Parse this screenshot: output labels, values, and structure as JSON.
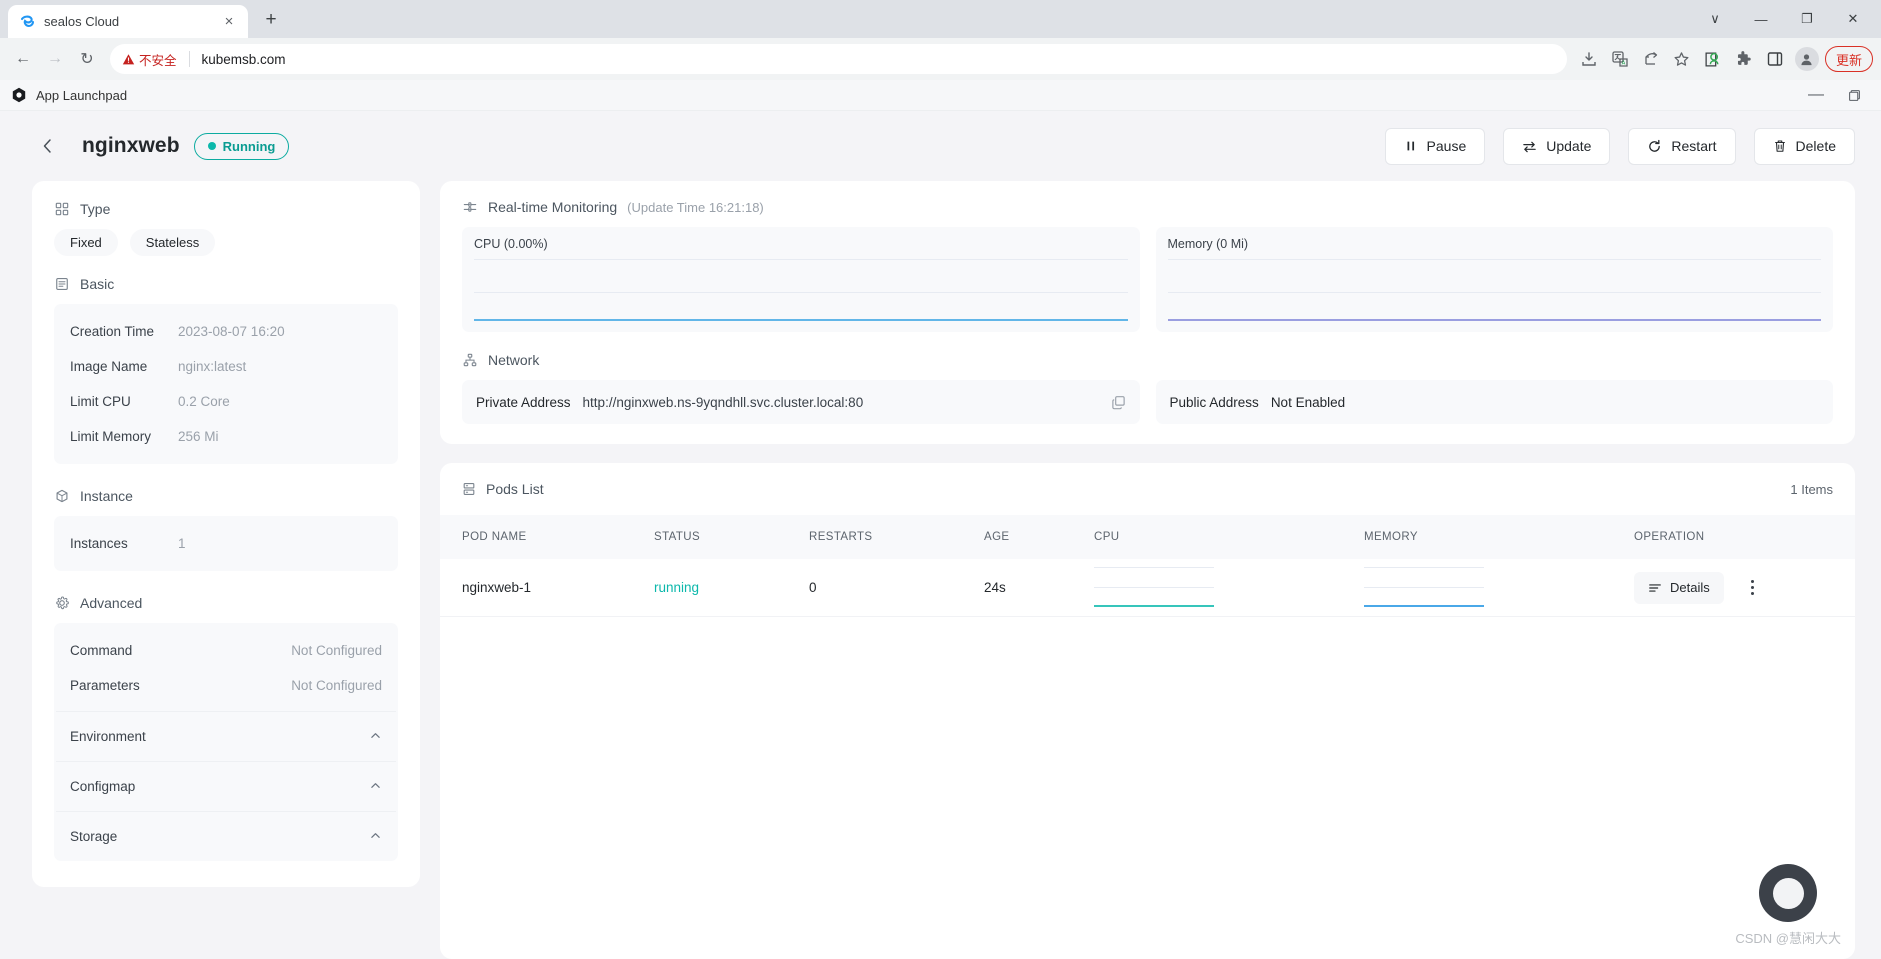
{
  "browser": {
    "tab": {
      "title": "sealos Cloud",
      "favicon": "sealos-logo-icon",
      "close": "×"
    },
    "new_tab_label": "+",
    "window_controls": {
      "minimize": "—",
      "maximize": "❐",
      "close": "✕",
      "more": "∨"
    },
    "nav": {
      "back": "←",
      "forward": "→",
      "reload": "↻"
    },
    "omnibox": {
      "security_text": "不安全",
      "url": "kubemsb.com"
    },
    "toolbar_icons": [
      "install-icon",
      "translate-icon",
      "share-icon",
      "bookmark-star-icon",
      "profile-badge-icon",
      "extensions-puzzle-icon",
      "side-panel-icon"
    ],
    "update_label": "更新"
  },
  "app_window": {
    "name": "App Launchpad",
    "logo": "sealos-app-icon",
    "minimize": "—",
    "maximize": "❐"
  },
  "header": {
    "back_icon": "chevron-left-icon",
    "title": "nginxweb",
    "status": "Running",
    "actions": [
      {
        "label": "Pause",
        "icon": "pause-icon"
      },
      {
        "label": "Update",
        "icon": "update-arrows-icon"
      },
      {
        "label": "Restart",
        "icon": "restart-icon"
      },
      {
        "label": "Delete",
        "icon": "trash-icon"
      }
    ]
  },
  "left_panel": {
    "type": {
      "title": "Type",
      "icon": "grid-icon",
      "chips": [
        "Fixed",
        "Stateless"
      ]
    },
    "basic": {
      "title": "Basic",
      "icon": "document-icon",
      "rows": [
        {
          "key": "Creation Time",
          "value": "2023-08-07 16:20"
        },
        {
          "key": "Image Name",
          "value": "nginx:latest"
        },
        {
          "key": "Limit CPU",
          "value": "0.2 Core"
        },
        {
          "key": "Limit Memory",
          "value": "256 Mi"
        }
      ]
    },
    "instance": {
      "title": "Instance",
      "icon": "cube-icon",
      "rows": [
        {
          "key": "Instances",
          "value": "1"
        }
      ]
    },
    "advanced": {
      "title": "Advanced",
      "icon": "gear-icon",
      "rows": [
        {
          "key": "Command",
          "value": "Not Configured"
        },
        {
          "key": "Parameters",
          "value": "Not Configured"
        }
      ],
      "collapsibles": [
        {
          "label": "Environment",
          "chevron": "chevron-up-icon"
        },
        {
          "label": "Configmap",
          "chevron": "chevron-up-icon"
        },
        {
          "label": "Storage",
          "chevron": "chevron-up-icon"
        }
      ]
    }
  },
  "monitoring": {
    "title": "Real-time Monitoring",
    "icon": "monitor-icon",
    "update_time": "(Update Time  16:21:18)",
    "cpu_label": "CPU  (0.00%)",
    "memory_label": "Memory  (0 Mi)"
  },
  "network": {
    "title": "Network",
    "icon": "network-icon",
    "private_key": "Private Address",
    "private_value": "http://nginxweb.ns-9yqndhll.svc.cluster.local:80",
    "copy_icon": "copy-icon",
    "public_key": "Public Address",
    "public_value": "Not Enabled"
  },
  "pods": {
    "title": "Pods List",
    "icon": "list-icon",
    "items_count": "1 Items",
    "columns": [
      "POD NAME",
      "STATUS",
      "RESTARTS",
      "AGE",
      "CPU",
      "MEMORY",
      "OPERATION"
    ],
    "rows": [
      {
        "pod_name": "nginxweb-1",
        "status": "running",
        "restarts": "0",
        "age": "24s",
        "details_label": "Details",
        "details_icon": "lines-icon",
        "kebab_icon": "more-vertical-icon"
      }
    ]
  },
  "watermark": {
    "text": "CSDN @慧闲大大"
  },
  "colors": {
    "accent_teal": "#0cb8ab",
    "cpu_line": "#62b6e8",
    "memory_line": "#9a9ee0",
    "danger_red": "#d93025",
    "pod_cpu_line": "#36c5bb",
    "pod_mem_line": "#4aa8e8"
  },
  "chart_data": [
    {
      "type": "line",
      "title": "CPU  (0.00%)",
      "x": [
        0,
        1,
        2,
        3,
        4,
        5,
        6,
        7,
        8,
        9,
        10,
        11,
        12,
        13,
        14,
        15,
        16,
        17,
        18,
        19
      ],
      "series": [
        {
          "name": "CPU",
          "values": [
            0,
            0,
            0,
            0,
            0,
            0,
            0,
            0,
            0,
            0,
            0,
            0,
            0,
            0,
            0,
            0,
            0,
            0,
            0,
            0
          ],
          "color": "#62b6e8"
        }
      ],
      "ylim": [
        0,
        1
      ],
      "xlabel": "",
      "ylabel": "",
      "grid": true,
      "legend": "none"
    },
    {
      "type": "line",
      "title": "Memory  (0 Mi)",
      "x": [
        0,
        1,
        2,
        3,
        4,
        5,
        6,
        7,
        8,
        9,
        10,
        11,
        12,
        13,
        14,
        15,
        16,
        17,
        18,
        19
      ],
      "series": [
        {
          "name": "Memory",
          "values": [
            0,
            0,
            0,
            0,
            0,
            0,
            0,
            0,
            0,
            0,
            0,
            0,
            0,
            0,
            0,
            0,
            0,
            0,
            0,
            0
          ],
          "color": "#9a9ee0"
        }
      ],
      "ylim": [
        0,
        1
      ],
      "xlabel": "",
      "ylabel": "",
      "grid": true,
      "legend": "none"
    }
  ]
}
